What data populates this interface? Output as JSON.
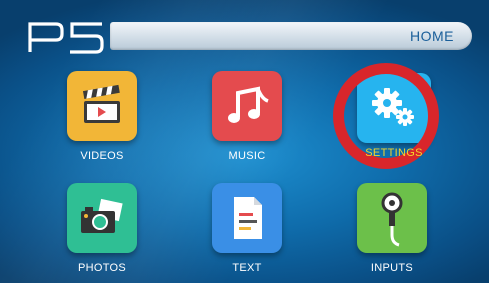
{
  "header": {
    "logo_text": "P5",
    "home_label": "HOME"
  },
  "apps": [
    {
      "label": "VIDEOS",
      "icon": "clapperboard-icon"
    },
    {
      "label": "MUSIC",
      "icon": "music-note-icon"
    },
    {
      "label": "SETTINGS",
      "icon": "gears-icon"
    },
    {
      "label": "PHOTOS",
      "icon": "camera-photos-icon"
    },
    {
      "label": "TEXT",
      "icon": "document-icon"
    },
    {
      "label": "INPUTS",
      "icon": "cable-plug-icon"
    }
  ],
  "colors": {
    "videos": "#f2b637",
    "music": "#e44b4e",
    "settings": "#26b4ef",
    "photos": "#2fbf94",
    "text": "#3a8fe6",
    "inputs": "#6cc04a",
    "highlight_ring": "#d8262b",
    "selected_label": "#f4d42a"
  },
  "selected_app": "SETTINGS"
}
